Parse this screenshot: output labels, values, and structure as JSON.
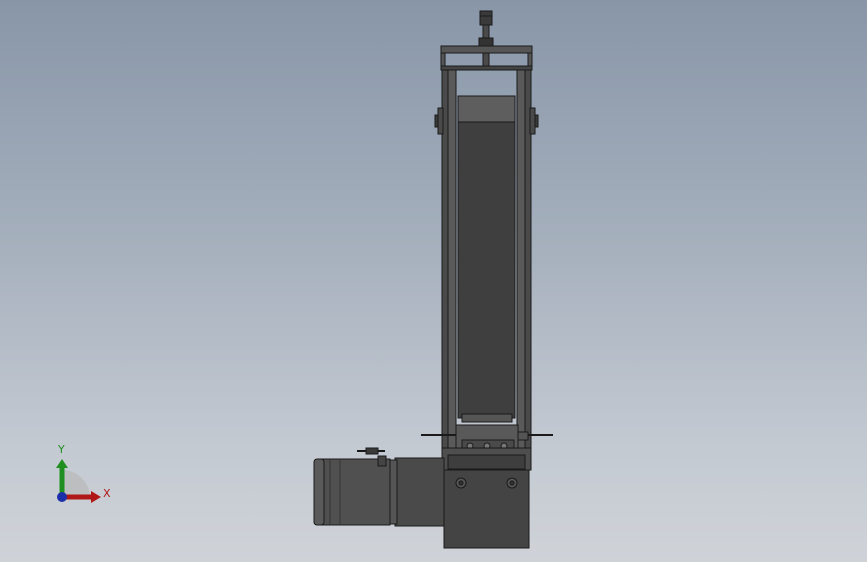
{
  "triad": {
    "x_label": "X",
    "y_label": "Y",
    "x_color": "#b01818",
    "y_color": "#1f8f1f",
    "z_color": "#1b2fa8"
  },
  "colors": {
    "background_top": "#8896a8",
    "background_bottom": "#cfd3d8",
    "part_dark": "#3a3a3a",
    "part_mid": "#4d4d4d",
    "part_light": "#626262",
    "edge": "#1a1a1a"
  }
}
